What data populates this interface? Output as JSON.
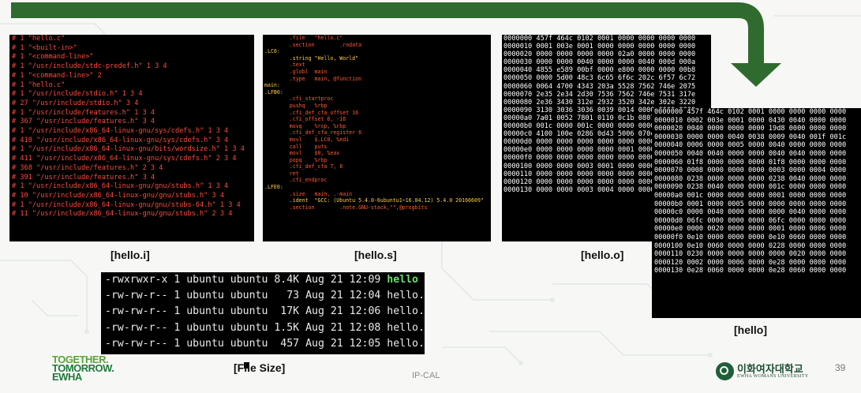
{
  "colors": {
    "arrow": "#2f6b2e",
    "terminal_bg": "#000000",
    "hello_i_text": "#ff4a3d",
    "exec_highlight": "#6be06b"
  },
  "panels": {
    "hello_i": {
      "caption": "[hello.i]",
      "lines": [
        "# 1 \"hello.c\"",
        "# 1 \"<built-in>\"",
        "# 1 \"<command-line>\"",
        "# 1 \"/usr/include/stdc-predef.h\" 1 3 4",
        "# 1 \"<command-line>\" 2",
        "# 1 \"hello.c\"",
        "# 1 \"/usr/include/stdio.h\" 1 3 4",
        "# 27 \"/usr/include/stdio.h\" 3 4",
        "# 1 \"/usr/include/features.h\" 1 3 4",
        "# 367 \"/usr/include/features.h\" 3 4",
        "# 1 \"/usr/include/x86_64-linux-gnu/sys/cdefs.h\" 1 3 4",
        "# 410 \"/usr/include/x86_64-linux-gnu/sys/cdefs.h\" 3 4",
        "# 1 \"/usr/include/x86_64-linux-gnu/bits/wordsize.h\" 1 3 4",
        "# 411 \"/usr/include/x86_64-linux-gnu/sys/cdefs.h\" 2 3 4",
        "# 368 \"/usr/include/features.h\" 2 3 4",
        "# 391 \"/usr/include/features.h\" 3 4",
        "# 1 \"/usr/include/x86_64-linux-gnu/gnu/stubs.h\" 1 3 4",
        "# 10 \"/usr/include/x86_64-linux-gnu/gnu/stubs.h\" 3 4",
        "# 1 \"/usr/include/x86_64-linux-gnu/gnu/stubs-64.h\" 1 3 4",
        "# 11 \"/usr/include/x86_64-linux-gnu/gnu/stubs.h\" 2 3 4"
      ]
    },
    "hello_s": {
      "caption": "[hello.s]",
      "lines": [
        "        .file   \"hello.c\"",
        "        .section        .rodata",
        ".LC0:",
        "        .string \"Hello, World\"",
        "        .text",
        "        .globl  main",
        "        .type   main, @function",
        "main:",
        ".LFB0:",
        "        .cfi_startproc",
        "        pushq   %rbp",
        "        .cfi_def_cfa_offset 16",
        "        .cfi_offset 6, -16",
        "        movq    %rsp, %rbp",
        "        .cfi_def_cfa_register 6",
        "        movl    $.LC0, %edi",
        "        call    puts",
        "        movl    $0, %eax",
        "        popq    %rbp",
        "        .cfi_def_cfa 7, 8",
        "        ret",
        "        .cfi_endproc",
        ".LFE0:",
        "        .size   main, .-main",
        "        .ident  \"GCC: (Ubuntu 5.4.0-6ubuntu1~16.04.12) 5.4.0 20160609\"",
        "        .section        .note.GNU-stack,\"\",@progbits"
      ]
    },
    "hello_o": {
      "caption": "[hello.o]",
      "lines": [
        "0000000 457f 464c 0102 0001 0000 0000 0000 0000",
        "0000010 0001 003e 0001 0000 0000 0000 0000 0000",
        "0000020 0000 0000 0000 0000 02a0 0000 0000 0000",
        "0000030 0000 0000 0040 0000 0000 0040 000d 000a",
        "0000040 4855 e589 00bf 0000 e800 0000 0000 00b8",
        "0000050 0000 5d00 48c3 6c65 6f6c 202c 6f57 6c72",
        "0000060 0064 4700 4343 203a 5528 7562 746e 2075",
        "0000070 2e35 2e34 2d30 7536 7562 746e 7531 317e",
        "0000080 2e36 3430 312e 2932 3520 342e 302e 3220",
        "0000090 3130 3036 3036 0039 0014 0000 0000 0000",
        "00000a0 7a01 0052 7801 0110 0c1b 0807 0190 0000",
        "00000b0 001c 0000 001c 0000 0000 0000 001a 0000",
        "00000c0 4100 100e 0286 0d43 5006 070c 0008 0000",
        "00000d0 0000 0000 0000 0000 0000 0000 0000 0000",
        "00000e0 0000 0000 0000 0000 0001 0000 0004 fff1",
        "00000f0 0000 0000 0000 0000 0000 0000 0000 0000",
        "0000100 0000 0000 0003 0001 0000 0000 0000 0000",
        "0000110 0000 0000 0000 0000 0000 0000 0003 0003",
        "0000120 0000 0000 0000 0000 0000 0000 0000 0000",
        "0000130 0000 0000 0003 0004 0000 0000 0000 0000"
      ]
    },
    "hello": {
      "caption": "[hello]",
      "lines": [
        "0000000 457f 464c 0102 0001 0000 0000 0000 0000",
        "0000010 0002 003e 0001 0000 0430 0040 0000 0000",
        "0000020 0040 0000 0000 0000 19d8 0000 0000 0000",
        "0000030 0000 0000 0040 0038 0009 0040 001f 001c",
        "0000040 0006 0000 0005 0000 0040 0000 0000 0000",
        "0000050 0040 0040 0000 0000 0040 0040 0000 0000",
        "0000060 01f8 0000 0000 0000 01f8 0000 0000 0000",
        "0000070 0008 0000 0000 0000 0003 0000 0004 0000",
        "0000080 0238 0000 0000 0000 0238 0040 0000 0000",
        "0000090 0238 0040 0000 0000 001c 0000 0000 0000",
        "00000a0 001c 0000 0000 0000 0001 0000 0000 0000",
        "00000b0 0001 0000 0005 0000 0000 0000 0000 0000",
        "00000c0 0000 0040 0000 0000 0000 0040 0000 0000",
        "00000d0 06fc 0000 0000 0000 06fc 0000 0000 0000",
        "00000e0 0000 0020 0000 0000 0001 0000 0006 0000",
        "00000f0 0e10 0000 0000 0000 0e10 0060 0000 0000",
        "0000100 0e10 0060 0000 0000 0228 0000 0000 0000",
        "0000110 0230 0000 0000 0000 0000 0020 0000 0000",
        "0000120 0002 0000 0006 0000 0e28 0000 0000 0000",
        "0000130 0e28 0060 0000 0000 0e28 0060 0000 0000"
      ]
    },
    "file_size": {
      "caption": "[File Size]",
      "rows": [
        {
          "perms": "-rwxrwxr-x",
          "links": "1",
          "owner": "ubuntu",
          "group": "ubuntu",
          "size": "8.4K",
          "month": "Aug",
          "day": "21",
          "time": "12:09",
          "name": "hello",
          "exec": true
        },
        {
          "perms": "-rw-rw-r--",
          "links": "1",
          "owner": "ubuntu",
          "group": "ubuntu",
          "size": "73",
          "month": "Aug",
          "day": "21",
          "time": "12:04",
          "name": "hello.c",
          "exec": false
        },
        {
          "perms": "-rw-rw-r--",
          "links": "1",
          "owner": "ubuntu",
          "group": "ubuntu",
          "size": "17K",
          "month": "Aug",
          "day": "21",
          "time": "12:06",
          "name": "hello.i",
          "exec": false
        },
        {
          "perms": "-rw-rw-r--",
          "links": "1",
          "owner": "ubuntu",
          "group": "ubuntu",
          "size": "1.5K",
          "month": "Aug",
          "day": "21",
          "time": "12:08",
          "name": "hello.o",
          "exec": false
        },
        {
          "perms": "-rw-rw-r--",
          "links": "1",
          "owner": "ubuntu",
          "group": "ubuntu",
          "size": "457",
          "month": "Aug",
          "day": "21",
          "time": "12:05",
          "name": "hello.s",
          "exec": false
        }
      ]
    }
  },
  "footer": {
    "left_logo_line1": "TOGETHER.",
    "left_logo_line2": "TOMORROW.",
    "left_logo_line3": "EWHA",
    "center_text": "IP-CAL",
    "right_logo_korean": "이화여자대학교",
    "right_logo_english": "EWHA WOMANS UNIVERSITY",
    "page_number": "39"
  }
}
